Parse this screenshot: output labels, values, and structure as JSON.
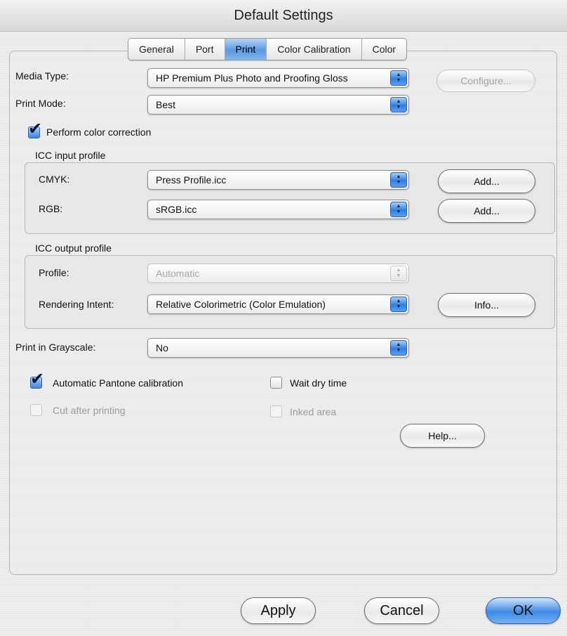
{
  "window": {
    "title": "Default Settings"
  },
  "tabs": [
    {
      "label": "General",
      "active": false
    },
    {
      "label": "Port",
      "active": false
    },
    {
      "label": "Print",
      "active": true
    },
    {
      "label": "Color Calibration",
      "active": false
    },
    {
      "label": "Color",
      "active": false
    }
  ],
  "media_type": {
    "label": "Media Type:",
    "value": "HP Premium Plus Photo and Proofing Gloss",
    "configure_label": "Configure..."
  },
  "print_mode": {
    "label": "Print Mode:",
    "value": "Best"
  },
  "color_correction": {
    "label": "Perform color correction",
    "checked": true
  },
  "icc_input": {
    "title": "ICC input profile",
    "cmyk": {
      "label": "CMYK:",
      "value": "Press Profile.icc",
      "add_label": "Add..."
    },
    "rgb": {
      "label": "RGB:",
      "value": "sRGB.icc",
      "add_label": "Add..."
    }
  },
  "icc_output": {
    "title": "ICC output profile",
    "profile": {
      "label": "Profile:",
      "value": "Automatic"
    },
    "rendering_intent": {
      "label": "Rendering Intent:",
      "value": "Relative Colorimetric (Color Emulation)",
      "info_label": "Info..."
    }
  },
  "grayscale": {
    "label": "Print in Grayscale:",
    "value": "No"
  },
  "options": {
    "pantone": {
      "label": "Automatic Pantone calibration",
      "checked": true
    },
    "wait_dry": {
      "label": "Wait dry time",
      "checked": false
    },
    "cut_after": {
      "label": "Cut after printing",
      "checked": false
    },
    "inked_area": {
      "label": "Inked area",
      "checked": false
    }
  },
  "buttons": {
    "help": "Help...",
    "apply": "Apply",
    "cancel": "Cancel",
    "ok": "OK"
  },
  "colors": {
    "accent": "#3e8ae6",
    "panel_bg": "#e9e9e9",
    "disabled_text": "#a6a6a6"
  }
}
